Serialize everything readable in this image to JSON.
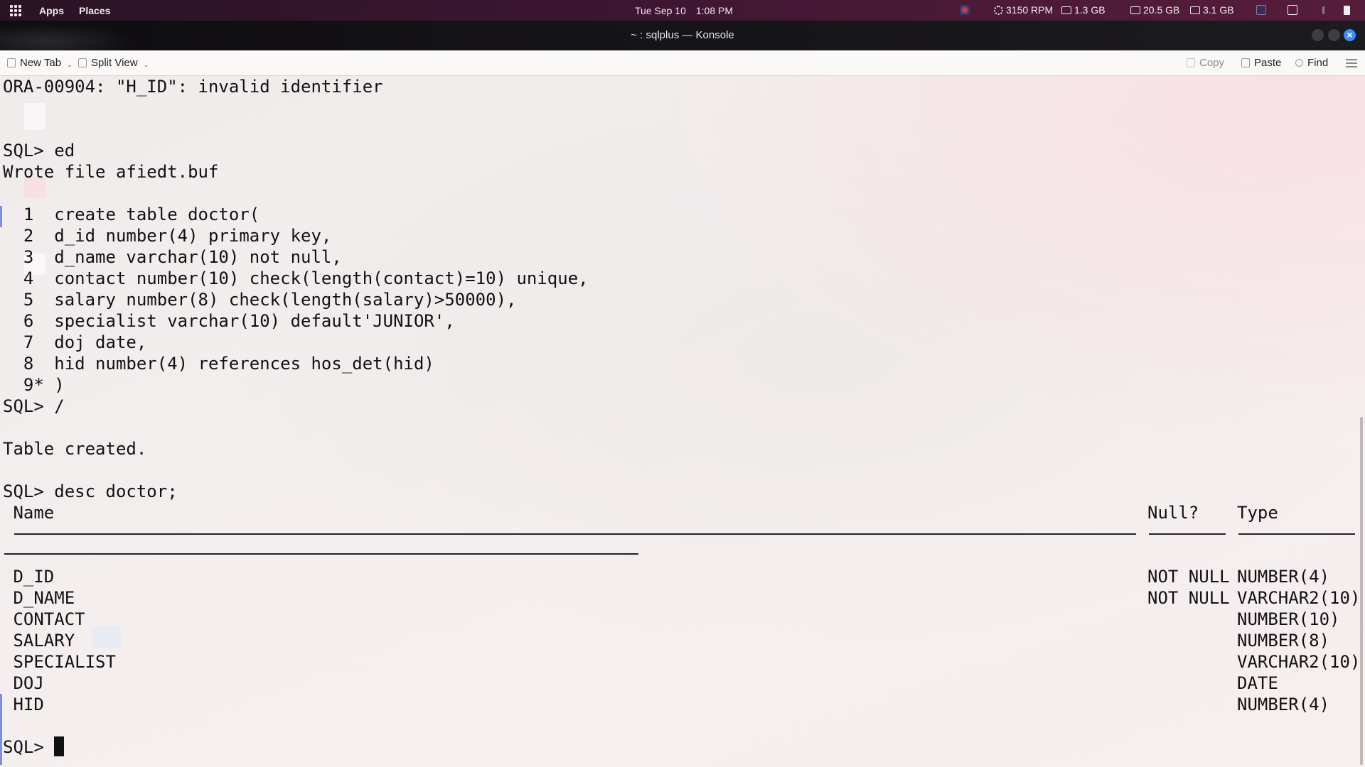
{
  "top_panel": {
    "apps": "Apps",
    "places": "Places",
    "date": "Tue Sep 10",
    "time": "1:08 PM",
    "fan": "3150 RPM",
    "mem1": "1.3 GB",
    "mem2": "20.5 GB",
    "mem3": "3.1 GB"
  },
  "window": {
    "title": "~ : sqlplus — Konsole"
  },
  "toolbar": {
    "new_tab": "New Tab",
    "split_view": "Split View",
    "copy": "Copy",
    "paste": "Paste",
    "find": "Find"
  },
  "terminal": {
    "error_line": "ORA-00904: \"H_ID\": invalid identifier",
    "prompt_ed": "SQL> ed",
    "wrote_file": "Wrote file afiedt.buf",
    "buffer_lines": [
      "  1  create table doctor(",
      "  2  d_id number(4) primary key,",
      "  3  d_name varchar(10) not null,",
      "  4  contact number(10) check(length(contact)=10) unique,",
      "  5  salary number(8) check(length(salary)>50000),",
      "  6  specialist varchar(10) default'JUNIOR',",
      "  7  doj date,",
      "  8  hid number(4) references hos_det(hid)",
      "  9* )"
    ],
    "prompt_run": "SQL> /",
    "table_created": "Table created.",
    "prompt_desc": "SQL> desc doctor;",
    "desc_headers": {
      "name": " Name",
      "null": "Null?",
      "type": "Type"
    },
    "desc_rows": [
      {
        "name": " D_ID",
        "null": "NOT NULL",
        "type": "NUMBER(4)"
      },
      {
        "name": " D_NAME",
        "null": "NOT NULL",
        "type": "VARCHAR2(10)"
      },
      {
        "name": " CONTACT",
        "null": "",
        "type": "NUMBER(10)"
      },
      {
        "name": " SALARY",
        "null": "",
        "type": "NUMBER(8)"
      },
      {
        "name": " SPECIALIST",
        "null": "",
        "type": "VARCHAR2(10)"
      },
      {
        "name": " DOJ",
        "null": "",
        "type": "DATE"
      },
      {
        "name": " HID",
        "null": "",
        "type": "NUMBER(4)"
      }
    ],
    "final_prompt": "SQL> "
  }
}
